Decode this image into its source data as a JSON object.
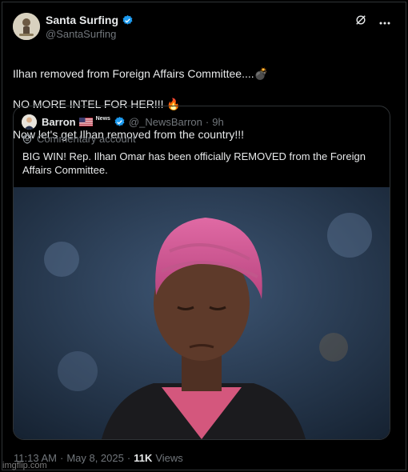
{
  "tweet": {
    "author_name": "Santa Surfing",
    "author_handle": "@SantaSurfing",
    "text_line1": "Ilhan removed from Foreign Affairs Committee....💣",
    "text_line2": "NO MORE INTEL FOR HER!!!  🔥",
    "text_line3": "Now let's get Ilhan removed from the country!!!"
  },
  "quote": {
    "author_name": "Barron",
    "badge_text": "News",
    "author_handle": "@_NewsBarron",
    "separator": "·",
    "time_ago": "9h",
    "commentary_label": "Commentary account",
    "text": "BIG WIN! Rep. Ilhan Omar has been officially REMOVED from the Foreign Affairs Committee."
  },
  "footer": {
    "time": "11:13 AM",
    "date": "May 8, 2025",
    "views_count": "11K",
    "views_label": "Views",
    "dot": "·"
  },
  "watermark": "imgflip.com",
  "colors": {
    "background": "#000000",
    "text_primary": "#e7e9ea",
    "text_secondary": "#71767b",
    "border": "#2f3336",
    "verified": "#1d9bf0"
  },
  "icons": [
    "verified-badge-icon",
    "grok-icon",
    "more-icon",
    "us-flag-icon",
    "commentary-shield-icon"
  ]
}
